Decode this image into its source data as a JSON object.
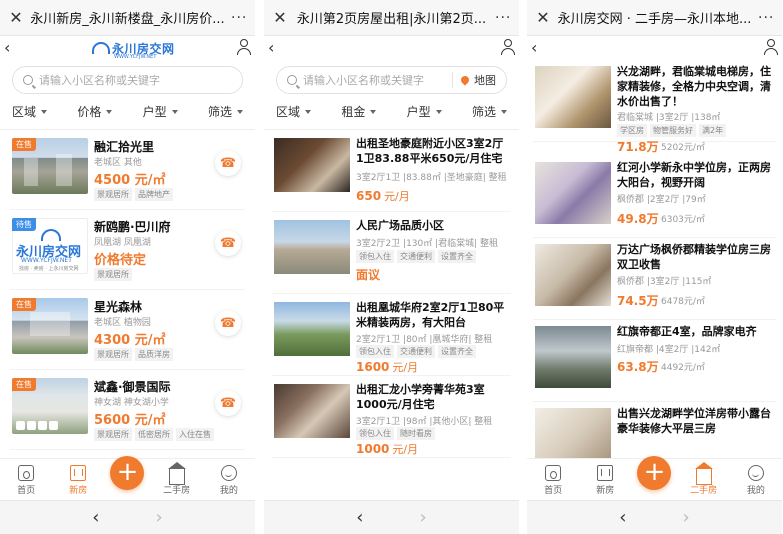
{
  "panels": [
    {
      "title": "永川新房_永川新楼盘_永川房价...",
      "logo": {
        "name": "永川房交网",
        "url": "WWW.YCFJW.NET"
      },
      "search_placeholder": "请输入小区名称或关键字",
      "filters": [
        "区域",
        "价格",
        "户型",
        "筛选"
      ],
      "listings": [
        {
          "tag": "在售",
          "name": "融汇拾光里",
          "loc": "老城区  其他",
          "price": "4500 元/㎡",
          "chips": [
            "景观居所",
            "品牌地产"
          ]
        },
        {
          "tag": "待售",
          "name": "新鸥鹏·巴川府",
          "loc": "凤凰湖  凤凰湖",
          "price": "价格待定",
          "chips": [
            "景观居所"
          ],
          "logo_text": "永川房交网",
          "logo_url": "WWW.YCFJW.NET",
          "logo_slogan": "找房 · 卖房  · 上永川房交网"
        },
        {
          "tag": "在售",
          "name": "星光森林",
          "loc": "老城区  植物园",
          "price": "4300 元/㎡",
          "chips": [
            "景观居所",
            "品质洋房"
          ]
        },
        {
          "tag": "在售",
          "name": "斌鑫·御景国际",
          "loc": "神女湖  神女湖小学",
          "price": "5600 元/㎡",
          "chips": [
            "景观居所",
            "低密居所",
            "入住在售"
          ]
        }
      ],
      "tabs": [
        "首页",
        "新房",
        "",
        "二手房",
        "我的"
      ],
      "active_tab": 1
    },
    {
      "title": "永川第2页房屋出租|永川第2页...",
      "search_placeholder": "请输入小区名称或关键字",
      "map_label": "地图",
      "filters": [
        "区域",
        "租金",
        "户型",
        "筛选"
      ],
      "listings": [
        {
          "title": "出租圣地豪庭附近小区3室2厅1卫83.88平米650元/月住宅",
          "meta": "3室2厅1卫 |83.88㎡ |圣地豪庭| 整租",
          "chips": [],
          "price": "650",
          "unit": "元/月"
        },
        {
          "title": "人民广场品质小区",
          "meta": "3室2厅2卫 |130㎡ |君临棠城| 整租",
          "chips": [
            "领包入住",
            "交通便利",
            "设置齐全"
          ],
          "price": "面议",
          "unit": ""
        },
        {
          "title": "出租凰城华府2室2厅1卫80平米精装两房，有大阳台",
          "meta": "2室2厅1卫 |80㎡ |凰城华府| 整租",
          "chips": [
            "领包入住",
            "交通便利",
            "设置齐全"
          ],
          "price": "1600",
          "unit": "元/月"
        },
        {
          "title": "出租汇龙小学旁菁华苑3室1000元/月住宅",
          "meta": "3室2厅1卫 |98㎡ |其他小区| 整租",
          "chips": [
            "领包入住",
            "随时看房"
          ],
          "price": "1000",
          "unit": "元/月"
        }
      ]
    },
    {
      "title": "永川房交网 · 二手房—永川本地...",
      "listings": [
        {
          "title": "兴龙湖畔，君临棠城电梯房，住家精装修，全格力中央空调，清水价出售了！",
          "meta": "君临棠城 |3室2厅 |138㎡",
          "chips": [
            "学区房",
            "物管服务好",
            "满2年"
          ],
          "price": "71.8万",
          "unit": "5202元/㎡"
        },
        {
          "title": "红河小学新永中学位房，正两房大阳台，视野开阔",
          "meta": "枫侨郡 |2室2厅 |79㎡",
          "chips": [],
          "price": "49.8万",
          "unit": "6303元/㎡"
        },
        {
          "title": "万达广场枫侨郡精装学位房三房双卫收售",
          "meta": "枫侨郡 |3室2厅 |115㎡",
          "chips": [],
          "price": "74.5万",
          "unit": "6478元/㎡"
        },
        {
          "title": "红旗帝都正4室，品牌家电齐",
          "meta": "红旗帝都 |4室2厅 |142㎡",
          "chips": [],
          "price": "63.8万",
          "unit": "4492元/㎡"
        },
        {
          "title": "出售兴龙湖畔学位洋房带小露台豪华装修大平层三房",
          "meta": "",
          "chips": [],
          "price": "",
          "unit": ""
        }
      ],
      "tabs": [
        "首页",
        "新房",
        "",
        "二手房",
        "我的"
      ],
      "active_tab": 3
    }
  ],
  "browser": {
    "back": "‹",
    "forward": "›",
    "close": "✕",
    "more": "···"
  },
  "colors": {
    "accent": "#f07a2e",
    "brand_blue": "#2b77d9"
  }
}
